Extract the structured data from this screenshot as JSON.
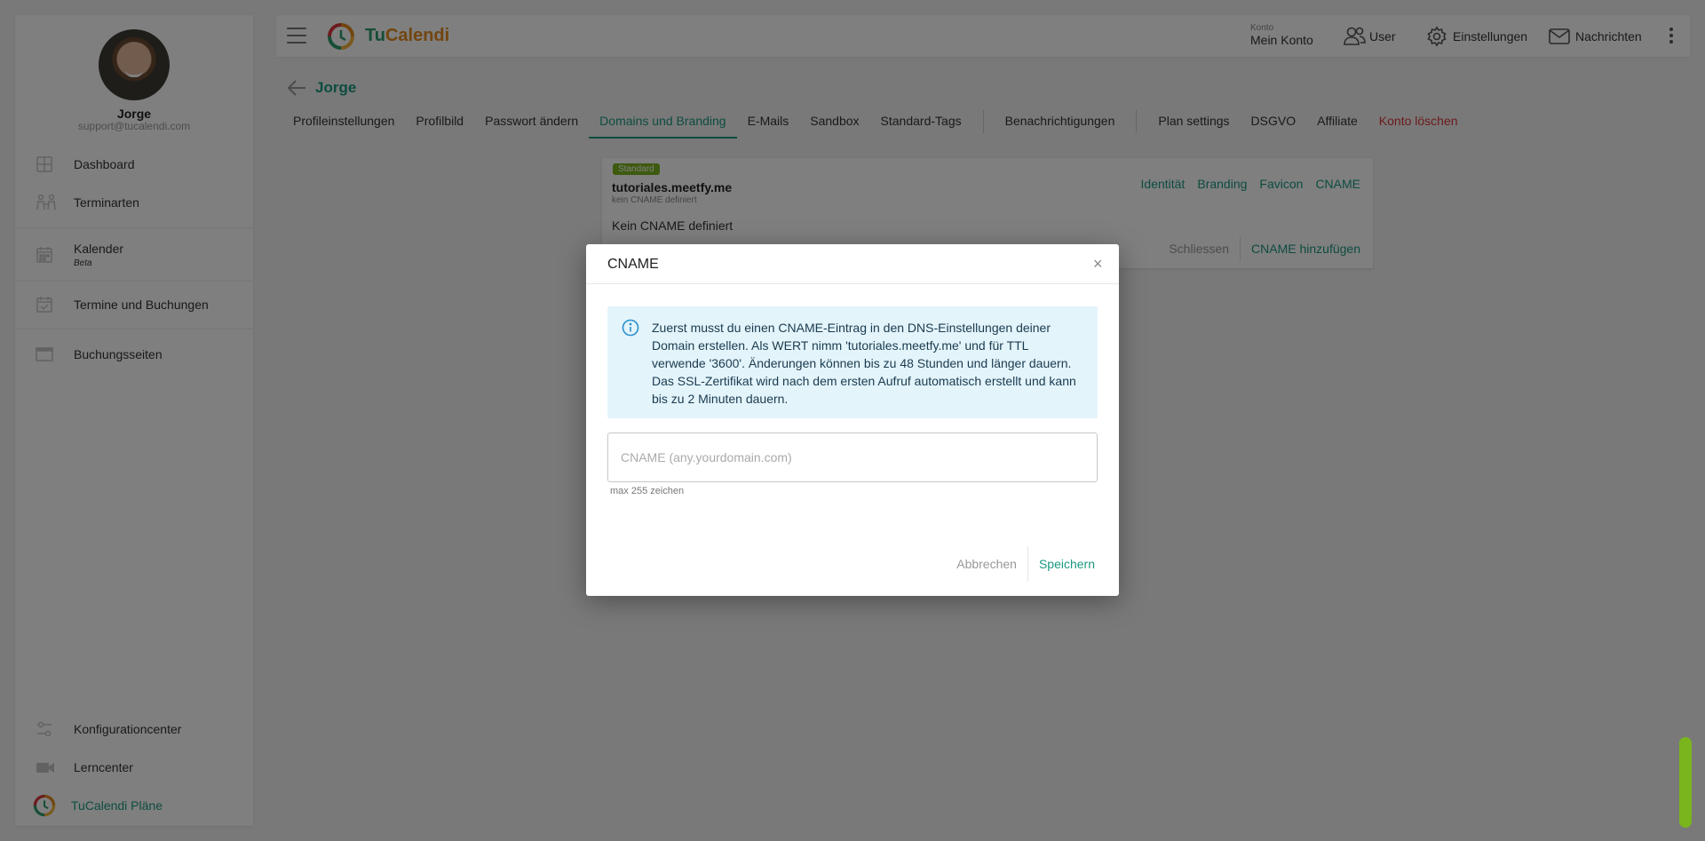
{
  "app": {
    "brand_part1": "Tu",
    "brand_part2": "Calendi",
    "accent_color": "#1b9980",
    "brand_green": "#2e9a6c",
    "brand_orange": "#e48b1e",
    "badge_color": "#7ab51d",
    "danger_color": "#d9373b"
  },
  "profile": {
    "name": "Jorge",
    "email": "support@tucalendi.com"
  },
  "sidebar": {
    "items": [
      {
        "label": "Dashboard",
        "icon": "dashboard-grid-icon"
      },
      {
        "label": "Terminarten",
        "icon": "people-icon"
      },
      {
        "label": "Kalender",
        "sublabel": "Beta",
        "icon": "calendar-icon"
      },
      {
        "label": "Termine und Buchungen",
        "icon": "calendar-check-icon"
      },
      {
        "label": "Buchungsseiten",
        "icon": "browser-window-icon"
      }
    ],
    "bottom_items": [
      {
        "label": "Konfigurationcenter",
        "icon": "sliders-icon"
      },
      {
        "label": "Lerncenter",
        "icon": "video-camera-icon"
      },
      {
        "label": "TuCalendi Pläne",
        "icon": "tucalendi-logo-icon"
      }
    ]
  },
  "topbar": {
    "konto_label": "Konto",
    "konto_value": "Mein Konto",
    "user": "User",
    "settings": "Einstellungen",
    "messages": "Nachrichten"
  },
  "page": {
    "title": "Jorge",
    "tabs": [
      "Profileinstellungen",
      "Profilbild",
      "Passwort ändern",
      "Domains und Branding",
      "E-Mails",
      "Sandbox",
      "Standard-Tags",
      "Benachrichtigungen",
      "Plan settings",
      "DSGVO",
      "Affiliate",
      "Konto löschen"
    ],
    "active_tab": "Domains und Branding"
  },
  "domain_card": {
    "badge": "Standard",
    "domain": "tutoriales.meetfy.me",
    "subtitle": "kein CNAME definiert",
    "links": [
      "Identität",
      "Branding",
      "Favicon",
      "CNAME"
    ],
    "message": "Kein CNAME definiert",
    "close_label": "Schliessen",
    "add_label": "CNAME hinzufügen"
  },
  "modal": {
    "title": "CNAME",
    "close_symbol": "×",
    "info_text": "Zuerst musst du einen CNAME-Eintrag in den DNS-Einstellungen deiner Domain erstellen. Als WERT nimm 'tutoriales.meetfy.me' und für TTL verwende '3600'. Änderungen können bis zu 48 Stunden und länger dauern. Das SSL-Zertifikat wird nach dem ersten Aufruf automatisch erstellt und kann bis zu 2 Minuten dauern.",
    "input_placeholder": "CNAME (any.yourdomain.com)",
    "input_value": "",
    "input_hint": "max 255 zeichen",
    "cancel_label": "Abbrechen",
    "save_label": "Speichern"
  }
}
